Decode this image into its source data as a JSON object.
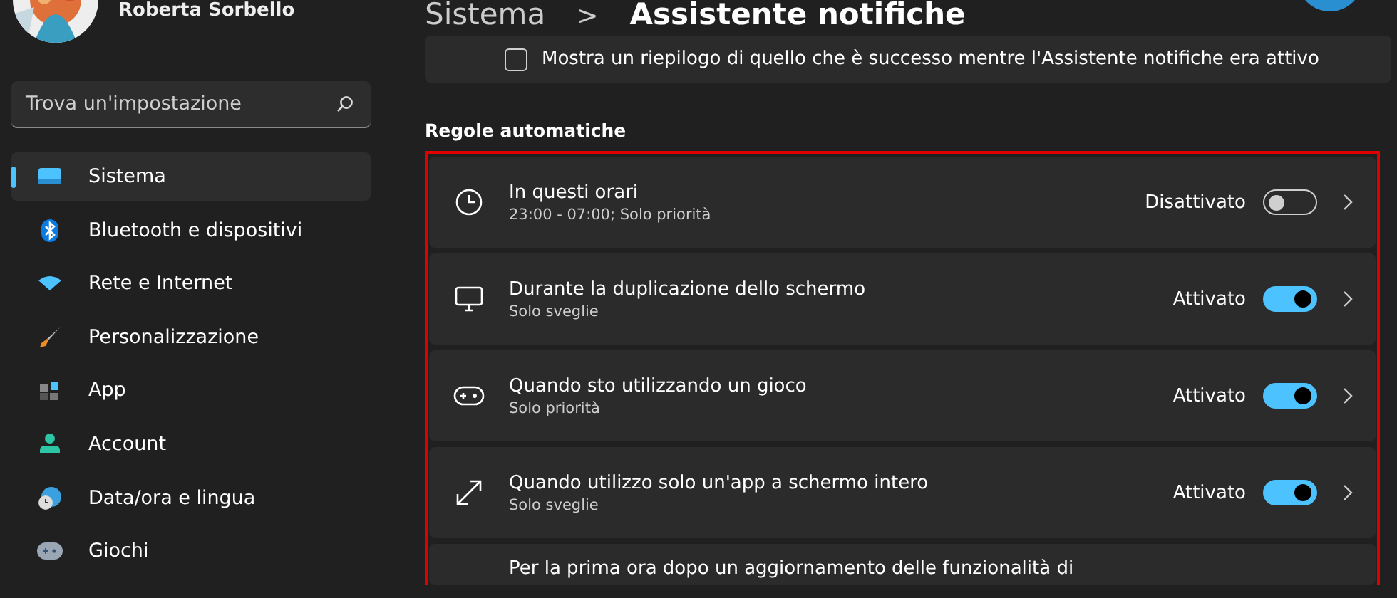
{
  "user": {
    "name": "Roberta Sorbello"
  },
  "search": {
    "placeholder": "Trova un'impostazione"
  },
  "sidebar": {
    "items": [
      {
        "label": "Sistema",
        "selected": true
      },
      {
        "label": "Bluetooth e dispositivi",
        "selected": false
      },
      {
        "label": "Rete e Internet",
        "selected": false
      },
      {
        "label": "Personalizzazione",
        "selected": false
      },
      {
        "label": "App",
        "selected": false
      },
      {
        "label": "Account",
        "selected": false
      },
      {
        "label": "Data/ora e lingua",
        "selected": false
      },
      {
        "label": "Giochi",
        "selected": false
      }
    ]
  },
  "header": {
    "breadcrumb": "Sistema",
    "separator": ">",
    "title": "Assistente notifiche"
  },
  "summary_option": {
    "label": "Mostra un riepilogo di quello che è successo mentre l'Assistente notifiche era attivo",
    "checked": false
  },
  "section": {
    "title": "Regole automatiche"
  },
  "rules": [
    {
      "title": "In questi orari",
      "subtitle": "23:00 - 07:00; Solo priorità",
      "status": "Disattivato",
      "on": false
    },
    {
      "title": "Durante la duplicazione dello schermo",
      "subtitle": "Solo sveglie",
      "status": "Attivato",
      "on": true
    },
    {
      "title": "Quando sto utilizzando un gioco",
      "subtitle": "Solo priorità",
      "status": "Attivato",
      "on": true
    },
    {
      "title": "Quando utilizzo solo un'app a schermo intero",
      "subtitle": "Solo sveglie",
      "status": "Attivato",
      "on": true
    },
    {
      "title": "Per la prima ora dopo un aggiornamento delle funzionalità di"
    }
  ]
}
